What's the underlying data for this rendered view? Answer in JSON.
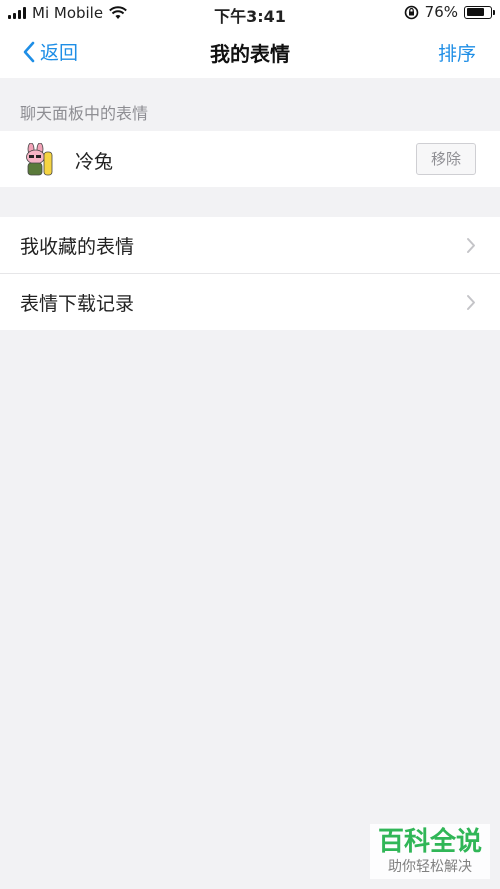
{
  "status_bar": {
    "carrier": "Mi Mobile",
    "time": "下午3:41",
    "battery": "76%",
    "battery_level": 0.76,
    "icons": [
      "signal-icon",
      "wifi-icon",
      "rotation-lock-icon",
      "battery-icon"
    ]
  },
  "nav": {
    "back_label": "返回",
    "title": "我的表情",
    "sort_label": "排序",
    "accent_color": "#1e8ee6"
  },
  "panel_section": {
    "header": "聊天面板中的表情",
    "items": [
      {
        "name": "冷兔",
        "action": "移除",
        "icon": "rabbit-sticker-icon"
      }
    ]
  },
  "menu": {
    "items": [
      {
        "label": "我收藏的表情",
        "icon": "chevron-right-icon"
      },
      {
        "label": "表情下载记录",
        "icon": "chevron-right-icon"
      }
    ]
  },
  "watermark": {
    "title": "百科全说",
    "subtitle": "助你轻松解决",
    "color": "#20b14a"
  }
}
